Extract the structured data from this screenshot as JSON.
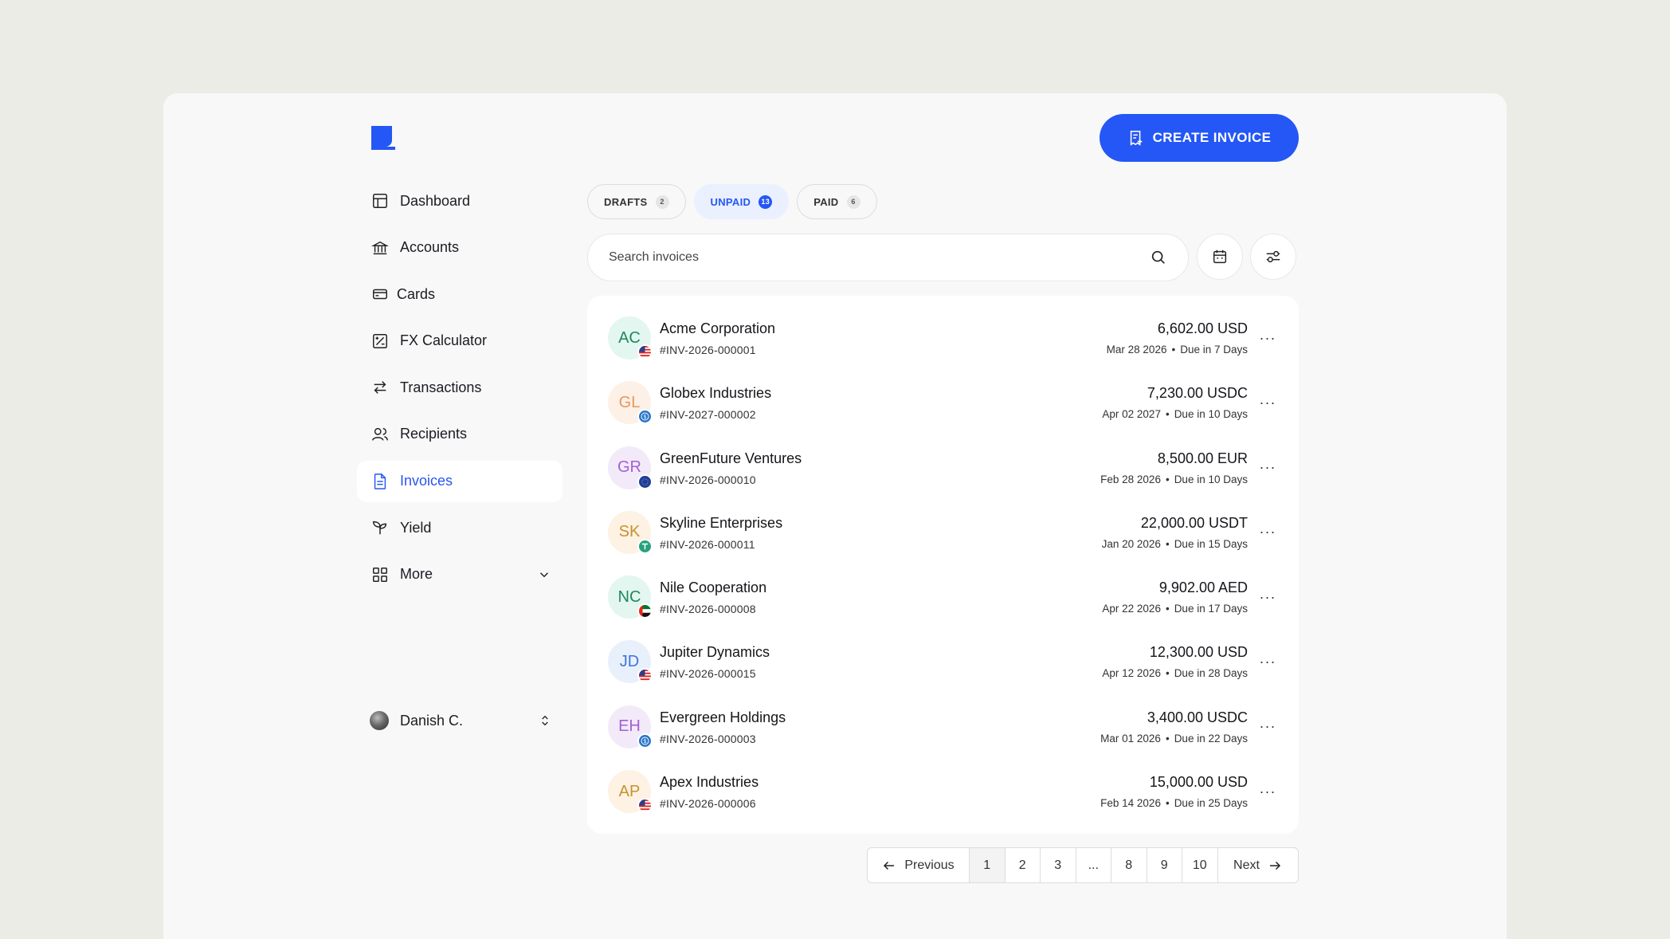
{
  "colors": {
    "accent": "#2457f5",
    "background": "#ecece6",
    "panel": "#f8f8f8"
  },
  "sidebar": {
    "items": [
      {
        "label": "Dashboard",
        "icon": "layout-icon"
      },
      {
        "label": "Accounts",
        "icon": "bank-icon"
      },
      {
        "label": "Cards",
        "icon": "card-icon"
      },
      {
        "label": "FX Calculator",
        "icon": "calculator-icon"
      },
      {
        "label": "Transactions",
        "icon": "arrows-icon"
      },
      {
        "label": "Recipients",
        "icon": "users-icon"
      },
      {
        "label": "Invoices",
        "icon": "document-icon",
        "active": true
      },
      {
        "label": "Yield",
        "icon": "sprout-icon"
      },
      {
        "label": "More",
        "icon": "grid-icon"
      }
    ],
    "user": {
      "name": "Danish C."
    }
  },
  "header": {
    "create_label": "CREATE INVOICE"
  },
  "tabs": [
    {
      "label": "DRAFTS",
      "count": "2"
    },
    {
      "label": "UNPAID",
      "count": "13",
      "active": true
    },
    {
      "label": "PAID",
      "count": "6"
    }
  ],
  "search": {
    "placeholder": "Search invoices"
  },
  "invoices": [
    {
      "initials": "AC",
      "name": "Acme Corporation",
      "number": "#INV-2026-000001",
      "amount": "6,602.00 USD",
      "date": "Mar 28 2026",
      "due": "Due in 7 Days",
      "avatar_bg": "#e3f6ef",
      "avatar_fg": "#1e8a5f",
      "badge": "us-flag-icon"
    },
    {
      "initials": "GL",
      "name": "Globex Industries",
      "number": "#INV-2027-000002",
      "amount": "7,230.00  USDC",
      "date": "Apr 02 2027",
      "due": "Due in 10 Days",
      "avatar_bg": "#fdf0e6",
      "avatar_fg": "#e6995d",
      "badge": "usdc-icon"
    },
    {
      "initials": "GR",
      "name": "GreenFuture Ventures",
      "number": "#INV-2026-000010",
      "amount": "8,500.00 EUR",
      "date": "Feb 28 2026",
      "due": "Due in 10 Days",
      "avatar_bg": "#f3eaf9",
      "avatar_fg": "#a35fd6",
      "badge": "eu-flag-icon"
    },
    {
      "initials": "SK",
      "name": "Skyline Enterprises",
      "number": "#INV-2026-000011",
      "amount": "22,000.00 USDT",
      "date": "Jan 20 2026",
      "due": "Due in 15 Days",
      "avatar_bg": "#fdf2e3",
      "avatar_fg": "#c8912f",
      "badge": "usdt-icon"
    },
    {
      "initials": "NC",
      "name": "Nile Cooperation",
      "number": "#INV-2026-000008",
      "amount": "9,902.00 AED",
      "date": "Apr 22 2026",
      "due": "Due in 17 Days",
      "avatar_bg": "#e3f6ef",
      "avatar_fg": "#1e8a5f",
      "badge": "ae-flag-icon"
    },
    {
      "initials": "JD",
      "name": "Jupiter Dynamics",
      "number": "#INV-2026-000015",
      "amount": "12,300.00 USD",
      "date": "Apr 12 2026",
      "due": "Due in 28 Days",
      "avatar_bg": "#e8f0fc",
      "avatar_fg": "#3f74d9",
      "badge": "us-flag-icon"
    },
    {
      "initials": "EH",
      "name": "Evergreen Holdings",
      "number": "#INV-2026-000003",
      "amount": "3,400.00 USDC",
      "date": "Mar 01 2026",
      "due": "Due in 22 Days",
      "avatar_bg": "#f3eaf9",
      "avatar_fg": "#a35fd6",
      "badge": "usdc-icon"
    },
    {
      "initials": "AP",
      "name": "Apex Industries",
      "number": "#INV-2026-000006",
      "amount": "15,000.00 USD",
      "date": "Feb 14 2026",
      "due": "Due in 25 Days",
      "avatar_bg": "#fdf2e3",
      "avatar_fg": "#c8912f",
      "badge": "us-flag-icon"
    }
  ],
  "pagination": {
    "previous": "Previous",
    "next": "Next",
    "pages": [
      "1",
      "2",
      "3",
      "...",
      "8",
      "9",
      "10"
    ],
    "current": "1"
  }
}
